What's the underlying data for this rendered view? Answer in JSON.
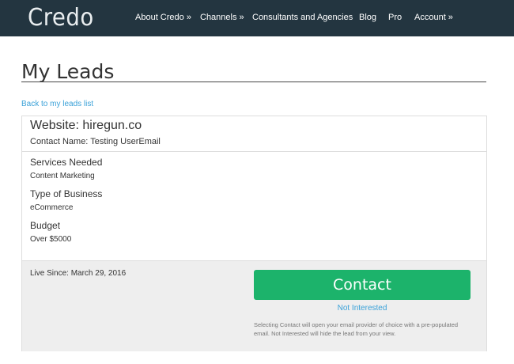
{
  "brand": {
    "logo": "Credo",
    "header_bg": "#233540",
    "accent_green": "#1cb36b",
    "link_blue": "#3aa1d8"
  },
  "nav": {
    "items": [
      {
        "label": "About Credo »"
      },
      {
        "label": "Channels »"
      },
      {
        "label": "Consultants and Agencies"
      },
      {
        "label": "Blog"
      },
      {
        "label": "Pro"
      },
      {
        "label": "Account »"
      }
    ]
  },
  "page": {
    "title": "My Leads",
    "back_link": "Back to my leads list"
  },
  "lead": {
    "website": "Website:  hiregun.co",
    "contact_name": "Contact Name:  Testing UserEmail",
    "details": [
      {
        "label": "Services Needed",
        "value": "Content Marketing"
      },
      {
        "label": "Type of Business",
        "value": "eCommerce"
      },
      {
        "label": "Budget",
        "value": "Over $5000"
      }
    ],
    "live_since": "Live Since:  March 29, 2016",
    "contact_button": "Contact",
    "not_interested": "Not Interested",
    "footnote": "Selecting Contact will open your email provider of choice with a pre-populated email. Not Interested will hide the lead from your view."
  }
}
